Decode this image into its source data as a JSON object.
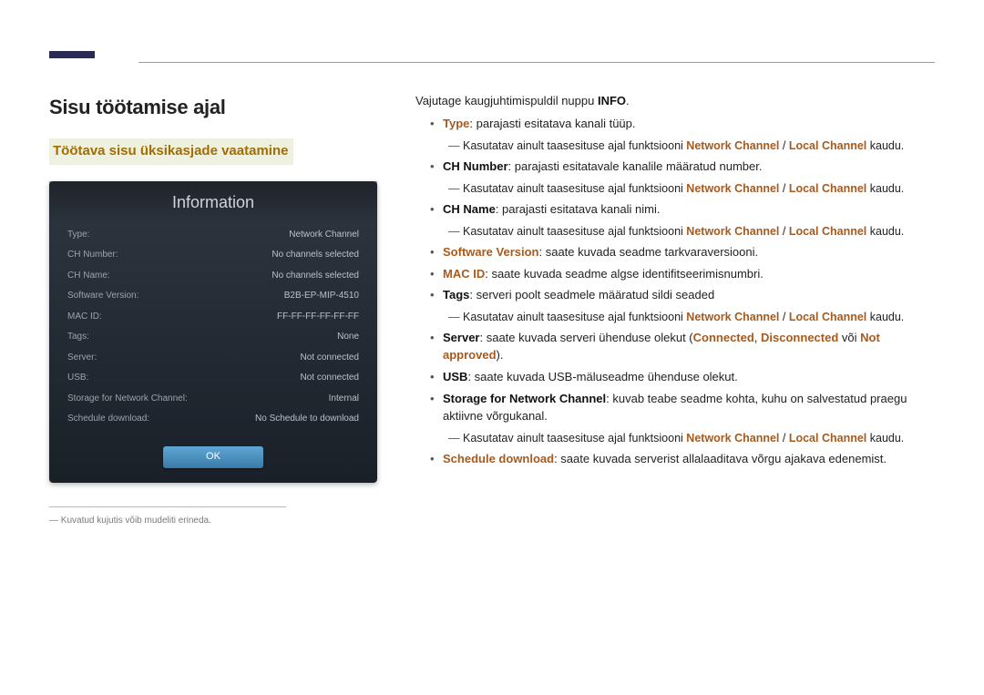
{
  "left": {
    "heading": "Sisu töötamise ajal",
    "subheading": "Töötava sisu üksikasjade vaatamine",
    "screenshot": {
      "title": "Information",
      "rows": [
        {
          "label": "Type:",
          "value": "Network Channel"
        },
        {
          "label": "CH Number:",
          "value": "No channels selected"
        },
        {
          "label": "CH Name:",
          "value": "No channels selected"
        },
        {
          "label": "Software Version:",
          "value": "B2B-EP-MIP-4510"
        },
        {
          "label": "MAC ID:",
          "value": "FF-FF-FF-FF-FF-FF"
        },
        {
          "label": "Tags:",
          "value": "None"
        },
        {
          "label": "Server:",
          "value": "Not connected"
        },
        {
          "label": "USB:",
          "value": "Not connected"
        },
        {
          "label": "Storage for Network Channel:",
          "value": "Internal"
        },
        {
          "label": "Schedule download:",
          "value": "No Schedule to download"
        }
      ],
      "ok": "OK"
    },
    "footnote": "Kuvatud kujutis võib mudeliti erineda."
  },
  "right": {
    "intro_prefix": "Vajutage kaugjuhtimispuldil nuppu ",
    "intro_bold": "INFO",
    "intro_suffix": ".",
    "sub_prefix": "Kasutatav ainult taasesituse ajal funktsiooni ",
    "sub_nc": "Network Channel",
    "sub_sep": " / ",
    "sub_lc": "Local Channel",
    "sub_suffix": " kaudu.",
    "items": {
      "type": {
        "label": "Type",
        "text": ": parajasti esitatava kanali tüüp."
      },
      "chnum": {
        "label": "CH Number",
        "text": ": parajasti esitatavale kanalile määratud number."
      },
      "chname": {
        "label": "CH Name",
        "text": ": parajasti esitatava kanali nimi."
      },
      "swver": {
        "label": "Software Version",
        "text": ": saate kuvada seadme tarkvaraversiooni."
      },
      "macid": {
        "label": "MAC ID",
        "text": ": saate kuvada seadme algse identifitseerimisnumbri."
      },
      "tags": {
        "label": "Tags",
        "text": ": serveri poolt seadmele määratud sildi seaded"
      },
      "server": {
        "label": "Server",
        "t1": ": saate kuvada serveri ühenduse olekut (",
        "c1": "Connected",
        "sep1": ", ",
        "c2": "Disconnected",
        "sep2": " või ",
        "c3": "Not approved",
        "t2": ")."
      },
      "usb": {
        "label": "USB",
        "text": ": saate kuvada USB-mäluseadme ühenduse olekut."
      },
      "storage": {
        "label": "Storage for Network Channel",
        "text": ": kuvab teabe seadme kohta, kuhu on salvestatud praegu aktiivne võrgukanal."
      },
      "sched": {
        "label": "Schedule download",
        "text": ": saate kuvada serverist allalaaditava võrgu ajakava edenemist."
      }
    }
  }
}
